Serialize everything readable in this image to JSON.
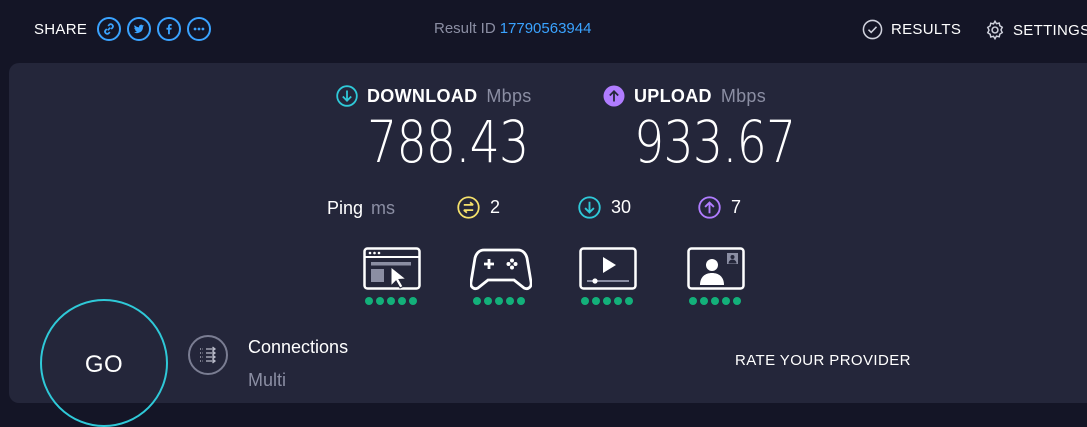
{
  "header": {
    "share_label": "SHARE",
    "share_icons": [
      "link-icon",
      "twitter-icon",
      "facebook-icon",
      "more-icon"
    ],
    "result_label": "Result ID",
    "result_id": "17790563944",
    "results_label": "RESULTS",
    "settings_label": "SETTINGS"
  },
  "download": {
    "label": "DOWNLOAD",
    "unit": "Mbps",
    "value": "788.43"
  },
  "upload": {
    "label": "UPLOAD",
    "unit": "Mbps",
    "value": "933.67"
  },
  "ping": {
    "label": "Ping",
    "unit": "ms",
    "idle": "2",
    "download": "30",
    "upload": "7"
  },
  "ratings": [
    {
      "icon": "web-browsing-icon",
      "score": 5,
      "max": 5
    },
    {
      "icon": "gaming-icon",
      "score": 5,
      "max": 5
    },
    {
      "icon": "video-streaming-icon",
      "score": 5,
      "max": 5
    },
    {
      "icon": "video-chat-icon",
      "score": 5,
      "max": 5
    }
  ],
  "go_label": "GO",
  "connections": {
    "title": "Connections",
    "value": "Multi"
  },
  "rate_provider": "RATE YOUR PROVIDER",
  "colors": {
    "accent_blue": "#3aa3ff",
    "download": "#2fc9d8",
    "upload": "#b07cff",
    "idle": "#f5e16b",
    "rating_dot": "#13b07a"
  }
}
